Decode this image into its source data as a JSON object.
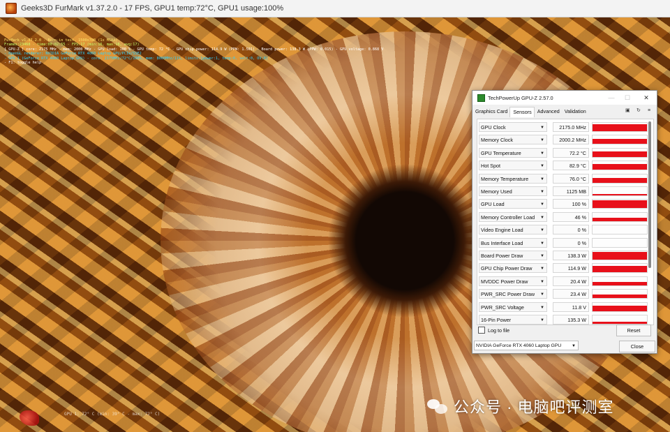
{
  "furmark": {
    "title": "Geeks3D FurMark v1.37.2.0 - 17 FPS, GPU1 temp:72°C, GPU1 usage:100%",
    "hud": [
      "FurMark v1.37.2.0 - Burn-in test, 1500x780 (1x MSAA)",
      "Frames:23468 - time:00:02:55 - FPS:17 (min:16, max:18, avg:17)",
      "[ GPU-Z ] core: 2175 MHz - mem: 2000 MHz - GPU load: 100 % - GPU temp: 72 °C - GPU chip power: 114.9 W (PPW: 1.501) - Board power: 138.3 W (PPW: 0.015) - GPU voltage: 0.868 V",
      "- OpenGL renderer: NVIDIA GeForce RTX 4060 Laptop GPU/PCIe/SSE2",
      "- GPU 1 (GeForce RTX 4060 Laptop GPU) - core: 2175MHz/72°C/100%, mem: 8000MHz/11%, limits:[power:1, temp:0, volt:0, OV:0]",
      "- F1: toggle help"
    ],
    "bottom_readout": "GPU 1: 72° C (min: 39° C - max: 72° C)"
  },
  "watermark": {
    "text": "公众号 · 电脑吧评测室",
    "icon": "wechat-icon"
  },
  "gpuz": {
    "title": "TechPowerUp GPU-Z 2.57.0",
    "controls": [
      "—",
      "☐",
      "✕"
    ],
    "tabs": [
      "Graphics Card",
      "Sensors",
      "Advanced",
      "Validation"
    ],
    "active_tab": "Sensors",
    "tool_icons": [
      "camera-icon",
      "refresh-icon",
      "menu-icon"
    ],
    "sensors": [
      {
        "name": "GPU Clock",
        "value": "2175.0 MHz",
        "level": 0.86
      },
      {
        "name": "Memory Clock",
        "value": "2000.2 MHz",
        "level": 0.62
      },
      {
        "name": "GPU Temperature",
        "value": "72.2 °C",
        "level": 0.66
      },
      {
        "name": "Hot Spot",
        "value": "82.9 °C",
        "level": 0.72
      },
      {
        "name": "Memory Temperature",
        "value": "76.0 °C",
        "level": 0.55
      },
      {
        "name": "Memory Used",
        "value": "1125 MB",
        "level": 0.15
      },
      {
        "name": "GPU Load",
        "value": "100 %",
        "level": 0.95
      },
      {
        "name": "Memory Controller Load",
        "value": "46 %",
        "level": 0.42
      },
      {
        "name": "Video Engine Load",
        "value": "0 %",
        "level": 0.0
      },
      {
        "name": "Bus Interface Load",
        "value": "0 %",
        "level": 0.0
      },
      {
        "name": "Board Power Draw",
        "value": "138.3 W",
        "level": 0.88
      },
      {
        "name": "GPU Chip Power Draw",
        "value": "114.9 W",
        "level": 0.8
      },
      {
        "name": "MVDDC Power Draw",
        "value": "20.4 W",
        "level": 0.42
      },
      {
        "name": "PWR_SRC Power Draw",
        "value": "23.4 W",
        "level": 0.46
      },
      {
        "name": "PWR_SRC Voltage",
        "value": "11.8 V",
        "level": 0.6
      },
      {
        "name": "16-Pin Power",
        "value": "135.3 W",
        "level": 0.22
      }
    ],
    "log_label": "Log to file",
    "reset_label": "Reset",
    "gpu_select": "NVIDIA GeForce RTX 4060 Laptop GPU",
    "close_label": "Close",
    "graph_color": "#e8101a"
  }
}
